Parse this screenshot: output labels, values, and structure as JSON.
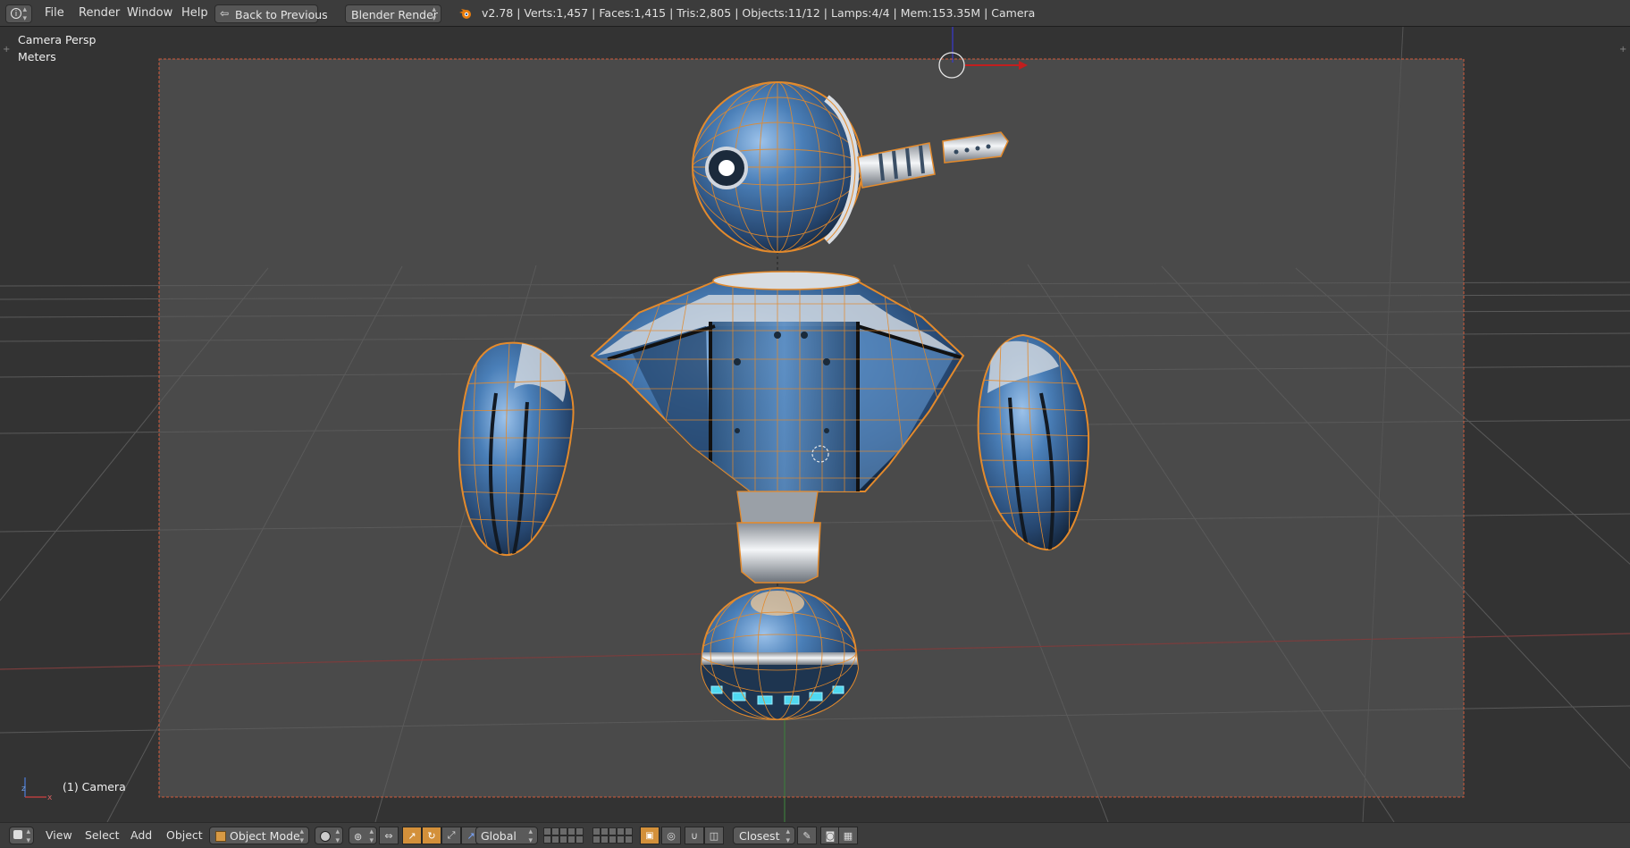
{
  "top_menu": {
    "items": [
      "File",
      "Render",
      "Window",
      "Help"
    ],
    "back_button": "Back to Previous",
    "engine": "Blender Render",
    "stats": "v2.78 | Verts:1,457 | Faces:1,415 | Tris:2,805 | Objects:11/12 | Lamps:4/4 | Mem:153.35M | Camera"
  },
  "viewport": {
    "view_name": "Camera Persp",
    "units": "Meters",
    "active_object": "(1) Camera"
  },
  "bottom_header": {
    "menu": [
      "View",
      "Select",
      "Add",
      "Object"
    ],
    "mode": "Object Mode",
    "orientation": "Global",
    "snap_target": "Closest"
  },
  "colors": {
    "header_bg": "#3c3c3c",
    "viewport_bg": "#393939",
    "selection_orange": "#e38a2c",
    "robot_blue": "#3f6ea6"
  }
}
